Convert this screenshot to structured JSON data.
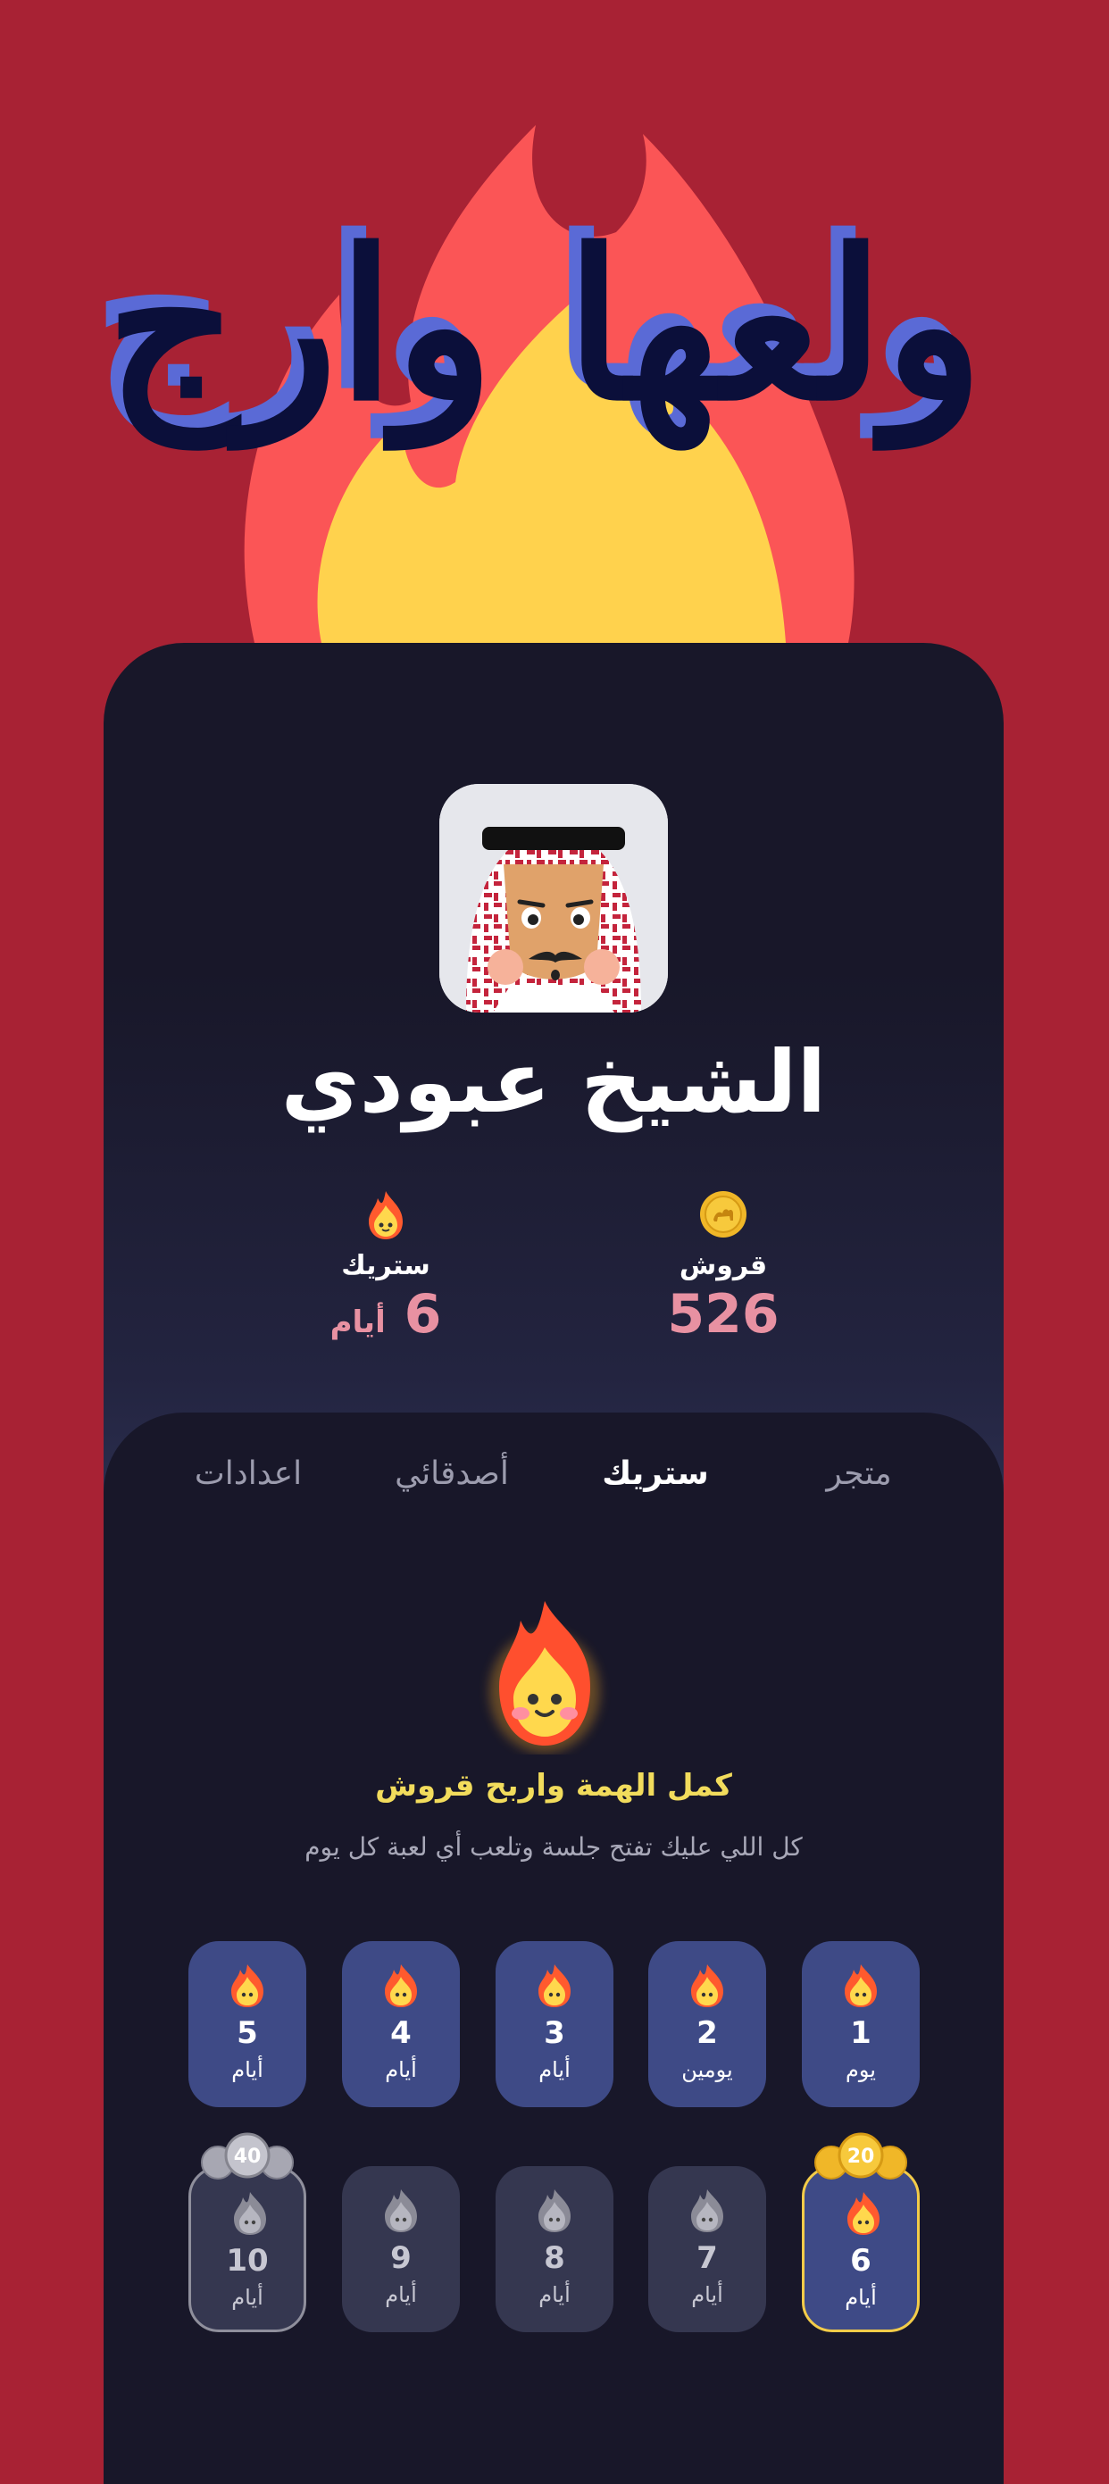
{
  "header": {
    "logo_text": "ولعها وارج"
  },
  "profile": {
    "name": "الشيخ عبودي",
    "coins": {
      "label": "قروش",
      "value": "526"
    },
    "streak": {
      "label": "ستريك",
      "value": "6",
      "unit": "أيام"
    }
  },
  "tabs": [
    {
      "label": "متجر",
      "active": false
    },
    {
      "label": "ستريك",
      "active": true
    },
    {
      "label": "أصدقائي",
      "active": false
    },
    {
      "label": "اعدادات",
      "active": false
    }
  ],
  "streak_section": {
    "headline": "كمل الهمة واربح قروش",
    "subline": "كل اللي عليك تفتح جلسة وتلعب أي لعبة كل يوم"
  },
  "days": [
    {
      "num": "1",
      "unit": "يوم",
      "state": "done"
    },
    {
      "num": "2",
      "unit": "يومين",
      "state": "done"
    },
    {
      "num": "3",
      "unit": "أيام",
      "state": "done"
    },
    {
      "num": "4",
      "unit": "أيام",
      "state": "done"
    },
    {
      "num": "5",
      "unit": "أيام",
      "state": "done"
    },
    {
      "num": "6",
      "unit": "أيام",
      "state": "done",
      "reward": "20"
    },
    {
      "num": "7",
      "unit": "أيام",
      "state": "locked"
    },
    {
      "num": "8",
      "unit": "أيام",
      "state": "locked"
    },
    {
      "num": "9",
      "unit": "أيام",
      "state": "locked"
    },
    {
      "num": "10",
      "unit": "أيام",
      "state": "locked",
      "reward": "40"
    }
  ],
  "colors": {
    "background": "#a82234",
    "card": "#181729",
    "accent_pink": "#e891a2",
    "accent_yellow": "#f2dc5c",
    "day_active": "#3e4a86",
    "day_locked": "#353750"
  }
}
